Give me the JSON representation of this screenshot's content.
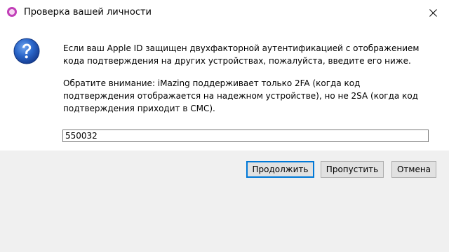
{
  "window": {
    "title": "Проверка вашей личности",
    "app_icon": "imazing-app-icon",
    "close_icon": "close-icon"
  },
  "dialog": {
    "icon": "question-icon",
    "message": "Если ваш Apple ID защищен двухфакторной аутентификацией с отображением кода подтверждения на других устройствах, пожалуйста, введите его ниже.",
    "note": "Обратите внимание: iMazing поддерживает только 2FA (когда код подтверждения отображается на надежном устройстве), но не 2SA (когда код подтверждения приходит в СМС).",
    "code_value": "550032"
  },
  "buttons": {
    "continue_label": "Продолжить",
    "skip_label": "Пропустить",
    "cancel_label": "Отмена"
  },
  "colors": {
    "accent": "#0078d7",
    "question_icon": "#1f5cc2",
    "app_icon": "#c13fb8"
  }
}
